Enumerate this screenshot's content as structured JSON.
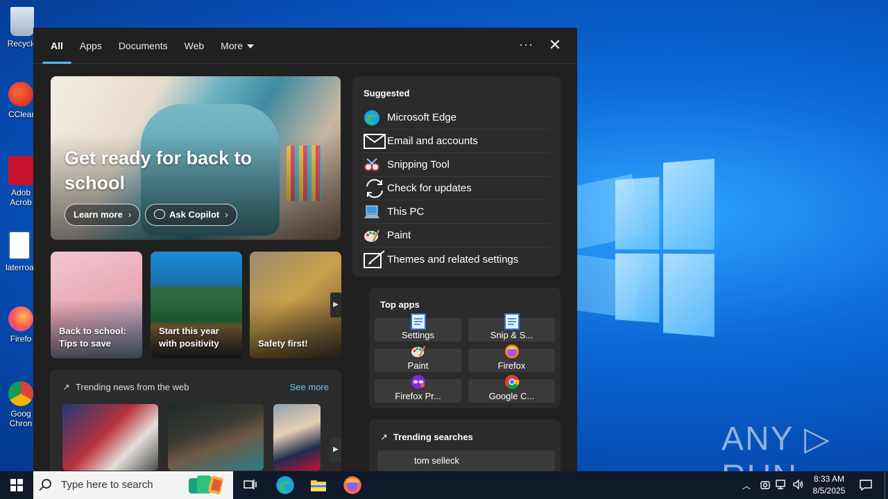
{
  "desktop": {
    "icons": [
      {
        "label": "Recycle",
        "name": "recycle-bin-icon"
      },
      {
        "label": "CClean",
        "name": "ccleaner-icon"
      },
      {
        "label": "Adob Acrob",
        "name": "adobe-acrobat-icon"
      },
      {
        "label": "laterroa",
        "name": "word-document-icon"
      },
      {
        "label": "Firefo",
        "name": "firefox-icon"
      },
      {
        "label": "Goog Chron",
        "name": "chrome-icon"
      }
    ],
    "watermark": "ANY ▷ RUN"
  },
  "search_panel": {
    "tabs": [
      {
        "label": "All",
        "active": true
      },
      {
        "label": "Apps"
      },
      {
        "label": "Documents"
      },
      {
        "label": "Web"
      },
      {
        "label": "More"
      }
    ],
    "more_menu": "···",
    "close": "✕",
    "hero": {
      "title": "Get ready for back to school",
      "learn_more": "Learn more",
      "ask_copilot": "Ask Copilot"
    },
    "cards": [
      {
        "label": "Back to school: Tips to save"
      },
      {
        "label": "Start this year with positivity"
      },
      {
        "label": "Safety first!"
      }
    ],
    "news": {
      "title": "Trending news from the web",
      "see_more": "See more"
    },
    "suggested": {
      "title": "Suggested",
      "items": [
        {
          "label": "Microsoft Edge",
          "icon": "edge-icon"
        },
        {
          "label": "Email and accounts",
          "icon": "mail-icon"
        },
        {
          "label": "Snipping Tool",
          "icon": "snipping-tool-icon"
        },
        {
          "label": "Check for updates",
          "icon": "refresh-icon"
        },
        {
          "label": "This PC",
          "icon": "computer-icon"
        },
        {
          "label": "Paint",
          "icon": "paint-icon"
        },
        {
          "label": "Themes and related settings",
          "icon": "themes-icon"
        }
      ]
    },
    "top_apps": {
      "title": "Top apps",
      "apps": [
        {
          "label": "Settings",
          "icon": "document-icon"
        },
        {
          "label": "Snip & S...",
          "icon": "document-icon"
        },
        {
          "label": "Paint",
          "icon": "paint-icon"
        },
        {
          "label": "Firefox",
          "icon": "firefox-icon"
        },
        {
          "label": "Firefox Pr...",
          "icon": "firefox-private-icon"
        },
        {
          "label": "Google C...",
          "icon": "chrome-icon"
        }
      ]
    },
    "trending_searches": {
      "title": "Trending searches",
      "items": [
        {
          "label": "tom selleck"
        }
      ]
    }
  },
  "taskbar": {
    "search_placeholder": "Type here to search",
    "time": "8:33 AM",
    "date": "8/5/2025"
  }
}
